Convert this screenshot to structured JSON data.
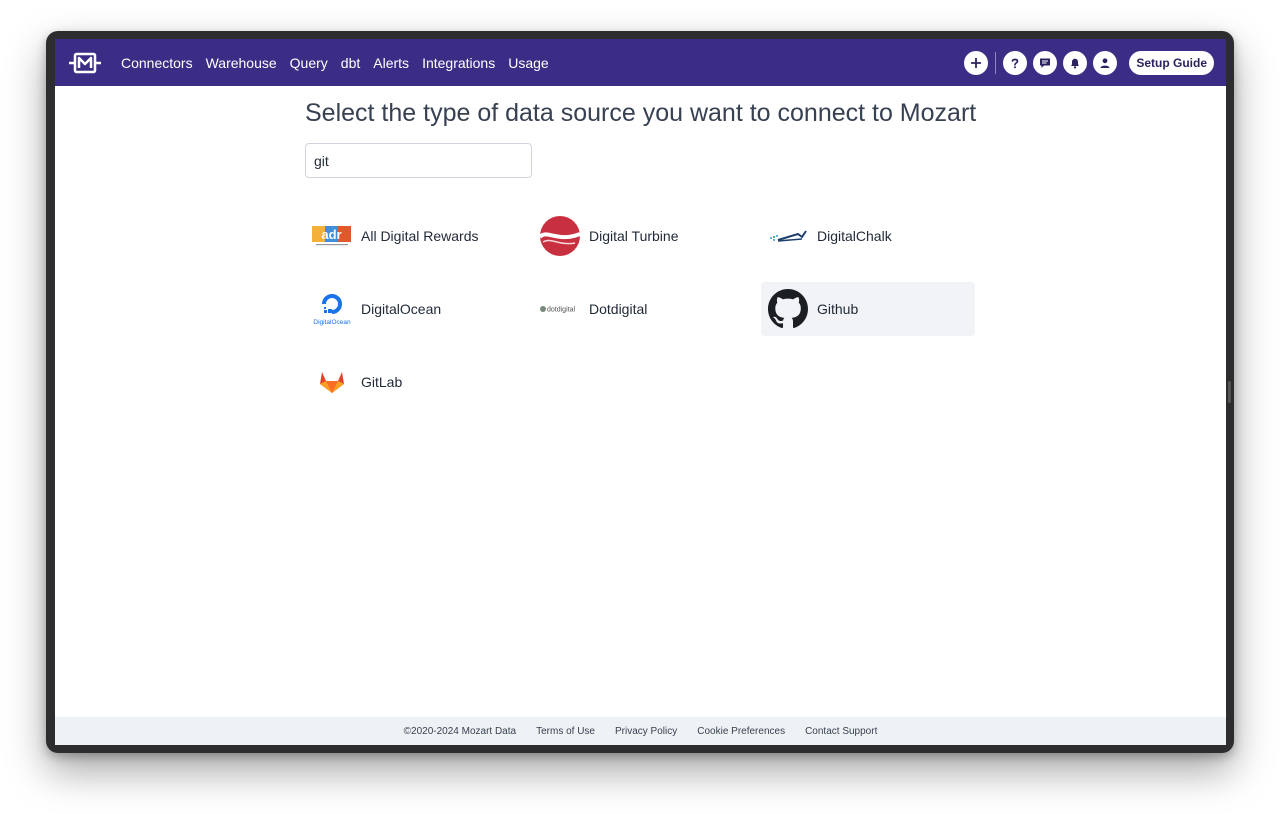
{
  "nav": {
    "links": [
      "Connectors",
      "Warehouse",
      "Query",
      "dbt",
      "Alerts",
      "Integrations",
      "Usage"
    ],
    "setup_guide": "Setup Guide",
    "brand_color": "#3b2d85"
  },
  "main": {
    "title": "Select the type of data source you want to connect to Mozart",
    "search_value": "git"
  },
  "connectors": [
    {
      "label": "All Digital Rewards",
      "icon": "adr-logo-icon"
    },
    {
      "label": "Digital Turbine",
      "icon": "digital-turbine-logo-icon"
    },
    {
      "label": "DigitalChalk",
      "icon": "digitalchalk-logo-icon"
    },
    {
      "label": "DigitalOcean",
      "icon": "digitalocean-logo-icon",
      "logo_text": "DigitalOcean"
    },
    {
      "label": "Dotdigital",
      "icon": "dotdigital-logo-icon",
      "logo_text": "dotdigital"
    },
    {
      "label": "Github",
      "icon": "github-logo-icon"
    },
    {
      "label": "GitLab",
      "icon": "gitlab-logo-icon"
    }
  ],
  "adr_logo_text": "adr",
  "footer": {
    "copyright": "©2020-2024 Mozart Data",
    "links": [
      "Terms of Use",
      "Privacy Policy",
      "Cookie Preferences",
      "Contact Support"
    ]
  }
}
